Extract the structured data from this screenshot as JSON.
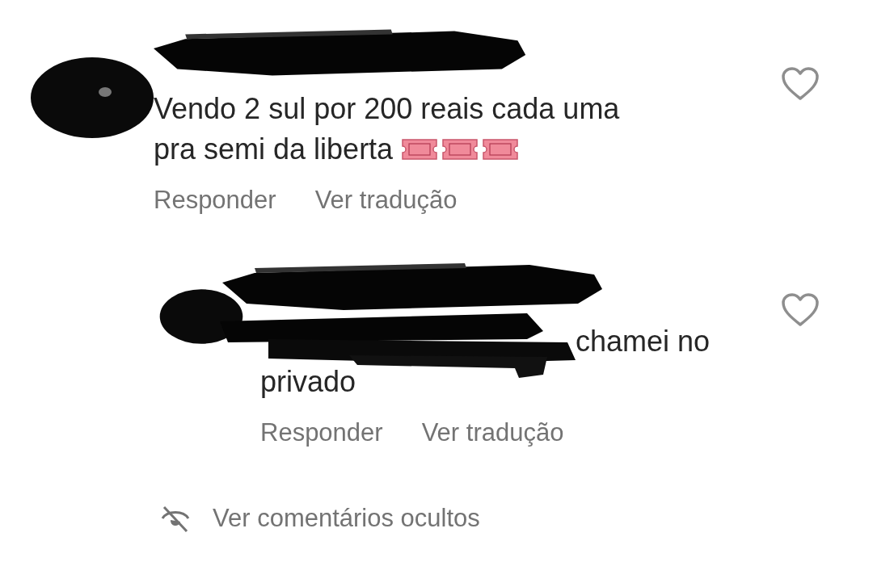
{
  "comments": [
    {
      "lines": [
        "Vendo 2 sul por 200 reais cada uma",
        "pra semi da liberta"
      ],
      "emoji": [
        {
          "kind": "ticket"
        },
        {
          "kind": "ticket"
        },
        {
          "kind": "ticket"
        }
      ],
      "liked": false,
      "actions": [
        "Responder",
        "Ver tradução"
      ]
    },
    {
      "lines": [
        "chamei no",
        "privado"
      ],
      "liked": false,
      "actions": [
        "Responder",
        "Ver tradução"
      ]
    }
  ],
  "hidden_comments": {
    "label": "Ver comentários ocultos"
  }
}
